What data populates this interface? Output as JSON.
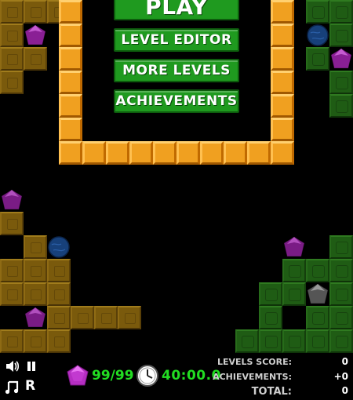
{
  "menu": {
    "play_label": "PLAY",
    "level_editor_label": "LEVEL EDITOR",
    "more_levels_label": "MORE LEVELS",
    "achievements_label": "ACHIEVEMENTS"
  },
  "hud": {
    "gems": "99/99",
    "time": "40:00.0",
    "levels_score_label": "LEVELS SCORE:",
    "levels_score_value": "0",
    "achievements_label": "ACHIEVEMENTS:",
    "achievements_value": "+0",
    "total_label": "TOTAL:",
    "total_value": "0",
    "sound_icon": "speaker-icon",
    "pause_icon": "pause-icon",
    "music_icon": "music-note-icon",
    "restart_icon": "restart-icon",
    "gem_icon": "gem-icon",
    "clock_icon": "clock-icon"
  },
  "colors": {
    "dirt": "#7a5a0c",
    "grass": "#1f5c14",
    "brick": "#f0a020",
    "button": "#1f9a1f",
    "gem": "#c23ad0",
    "time_text": "#22dd22"
  }
}
